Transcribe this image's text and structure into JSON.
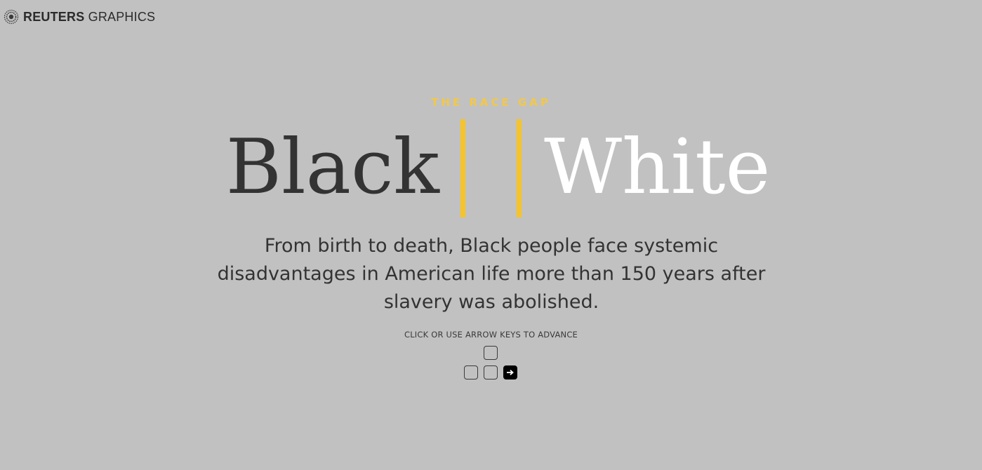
{
  "header": {
    "logo_icon": "reuters-dot-ring-icon",
    "brand_bold": "REUTERS",
    "brand_light": " GRAPHICS"
  },
  "hero": {
    "kicker": "THE RACE GAP",
    "title_left": "Black",
    "title_right": "White",
    "description": "From birth to death, Black people face systemic disadvantages in American life more than 150 years after slavery was abolished."
  },
  "navigation": {
    "instruction": "CLICK OR USE ARROW KEYS TO ADVANCE",
    "active_key_icon": "arrow-right-icon"
  },
  "colors": {
    "background": "#c1c1c1",
    "accent": "#f6c428",
    "dark_text": "#333333",
    "light_text": "#ffffff"
  }
}
